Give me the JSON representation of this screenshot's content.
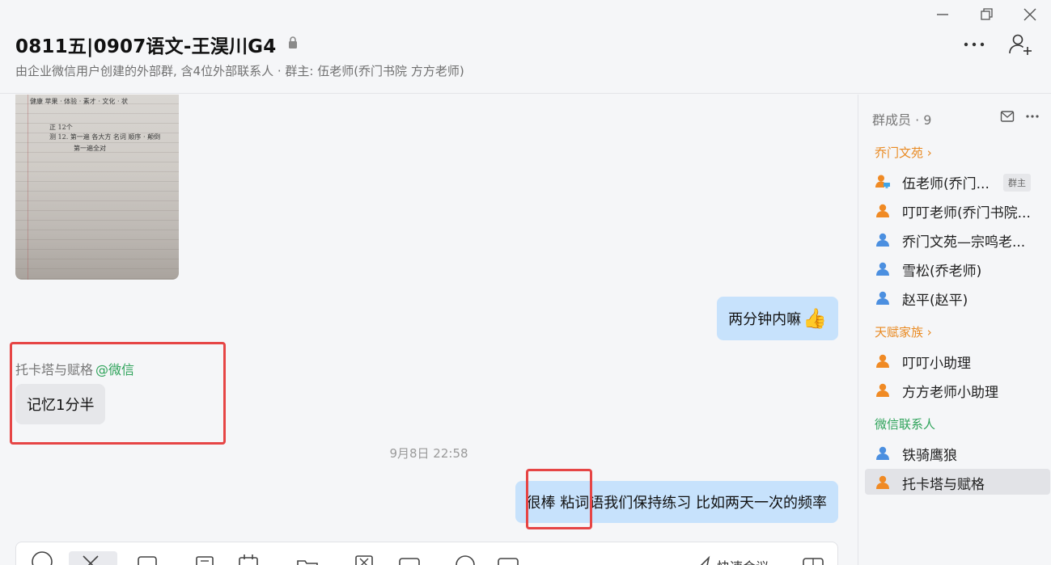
{
  "header": {
    "title": "0811五|0907语文-王淏川G4",
    "subtitle": "由企业微信用户创建的外部群, 含4位外部联系人 · 群主: 伍老师(乔门书院 方方老师)"
  },
  "photo_notes": {
    "line1": "健康  苹果  · 体验  · 素才  · 文化  · 状",
    "line2": "正  12个",
    "line3": "测 12.  第一遍  各大方 名词 顺序 · 颠倒",
    "line4": "第一遍全对"
  },
  "messages": {
    "msg1": "两分钟内嘛",
    "msg1_emoji": "👍",
    "msg2_sender": "托卡塔与赋格",
    "msg2_source": "@微信",
    "msg2": "记忆1分半",
    "timestamp": "9月8日 22:58",
    "msg3": "很棒 粘词语我们保持练习 比如两天一次的频率"
  },
  "composer": {
    "quick_reply": "快速会议"
  },
  "sidebar": {
    "title": "群成员 · 9",
    "groups": [
      {
        "label": "乔门文苑",
        "members": [
          {
            "name": "伍老师(乔门...",
            "badge": "群主"
          },
          {
            "name": "叮叮老师(乔门书院..."
          },
          {
            "name": "乔门文苑—宗鸣老..."
          },
          {
            "name": "雪松(乔老师)"
          },
          {
            "name": "赵平(赵平)"
          }
        ]
      },
      {
        "label": "天赋家族",
        "members": [
          {
            "name": "叮叮小助理"
          },
          {
            "name": "方方老师小助理"
          }
        ]
      },
      {
        "label": "微信联系人",
        "members": [
          {
            "name": "铁骑鹰狼"
          },
          {
            "name": "托卡塔与赋格"
          }
        ]
      }
    ]
  },
  "colors": {
    "accent_blue_bubble": "#c7e2fc",
    "incoming_bubble": "#e6e7ea",
    "group_orange": "#e98a22",
    "group_green": "#2ea35a",
    "highlight_red": "#e64545"
  }
}
